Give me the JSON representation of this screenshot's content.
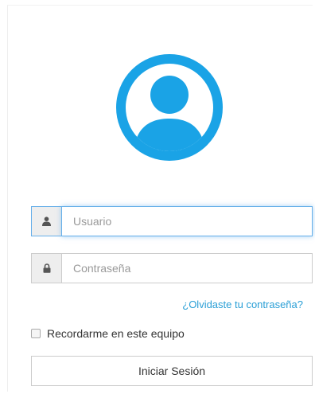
{
  "colors": {
    "accent": "#1aa3e6",
    "link": "#2a9fd6",
    "focus": "#66afe9"
  },
  "avatar": {
    "icon": "user-circle-icon"
  },
  "username": {
    "icon": "user-icon",
    "placeholder": "Usuario",
    "value": ""
  },
  "password": {
    "icon": "lock-icon",
    "placeholder": "Contraseña",
    "value": ""
  },
  "forgot_link": "¿Olvidaste tu contraseña?",
  "remember": {
    "label": "Recordarme en este equipo",
    "checked": false
  },
  "submit_label": "Iniciar Sesión"
}
